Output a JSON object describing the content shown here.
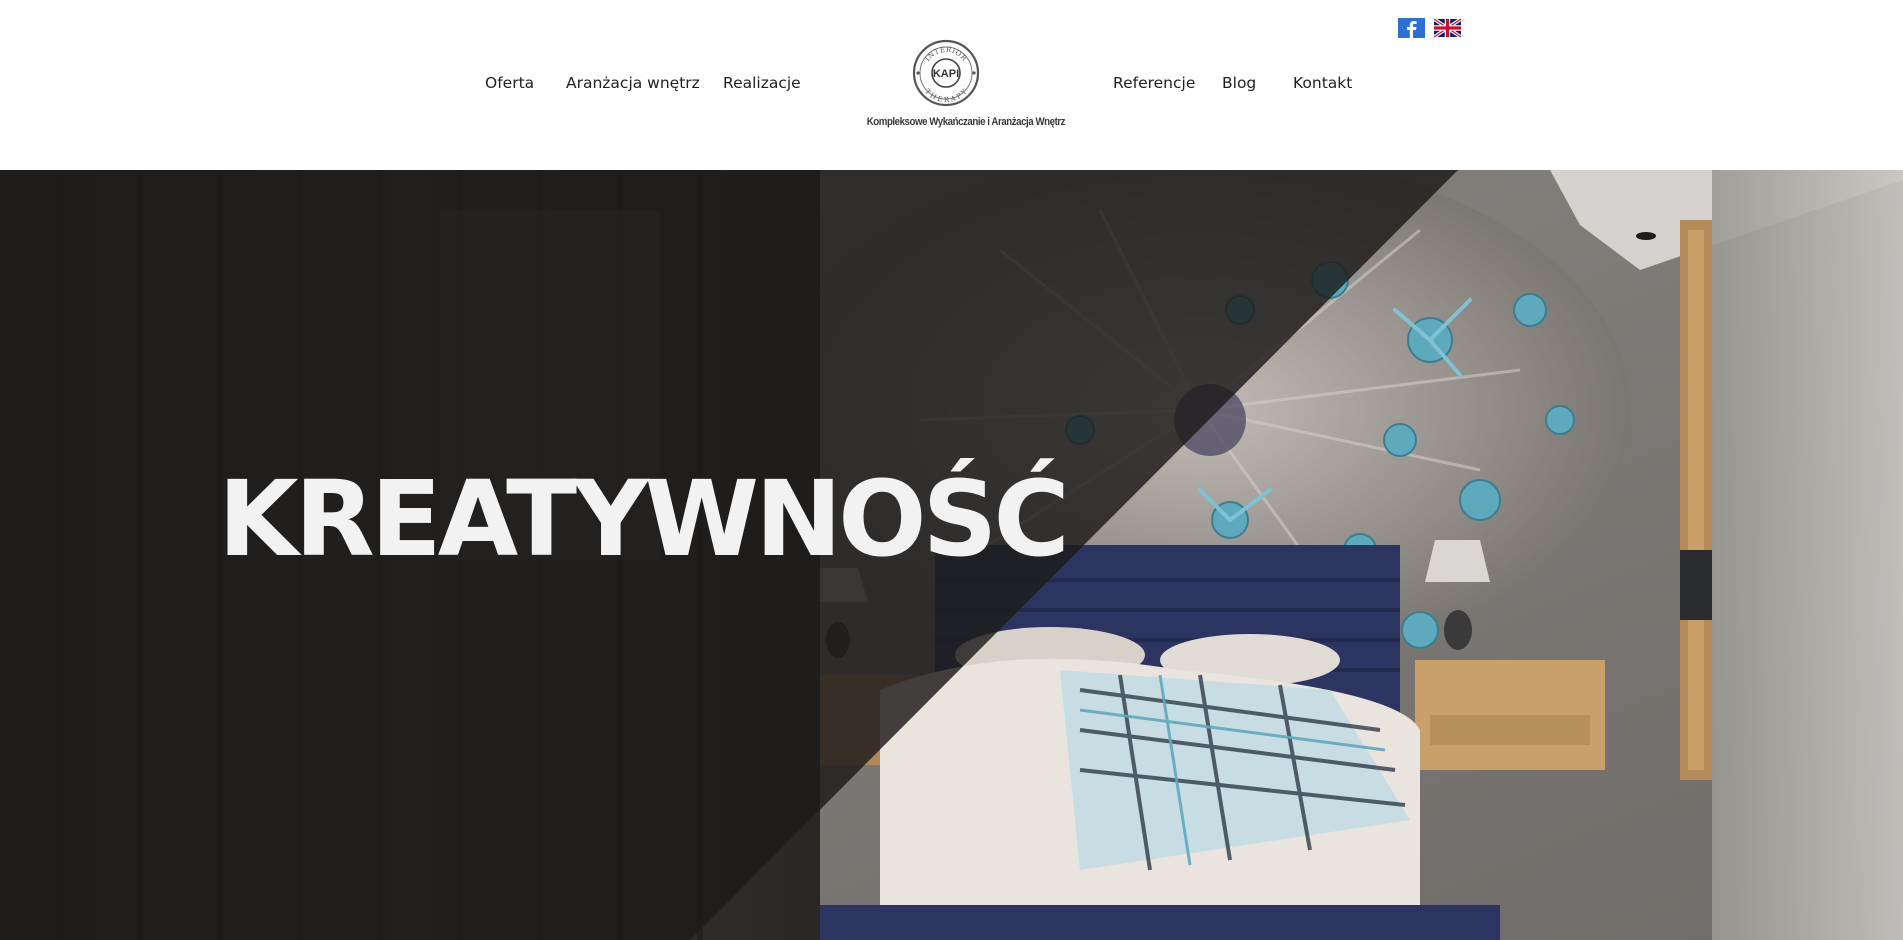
{
  "header": {
    "nav_left": [
      "Oferta",
      "Aranżacja wnętrz",
      "Realizacje"
    ],
    "nav_right": [
      "Referencje",
      "Blog",
      "Kontakt"
    ],
    "logo": {
      "center_text": "KAPI",
      "ring_top": "INTERIOR",
      "ring_bottom": "THERAPY",
      "tagline": "Kompleksowe Wykańczanie i Aranżacja Wnętrz"
    },
    "languages": [
      {
        "name": "facebook-icon"
      },
      {
        "name": "uk-flag-icon"
      }
    ]
  },
  "hero": {
    "title": "KREATYWNOŚĆ"
  },
  "colors": {
    "text": "#222222",
    "facebook": "#3b5998",
    "hero_overlay": "#1c1b1a",
    "flower": "#5fa9bd"
  }
}
